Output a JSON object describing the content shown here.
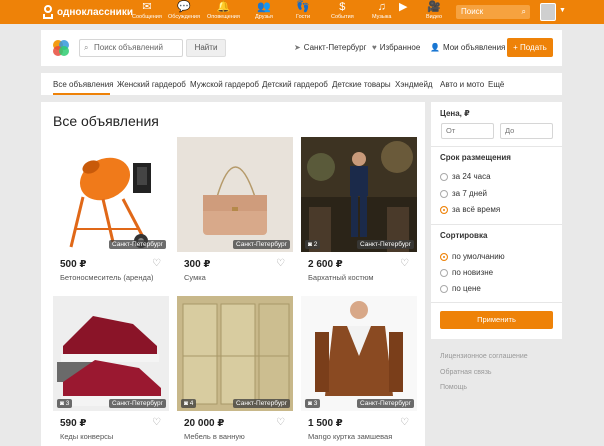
{
  "topbar": {
    "logo_text": "одноклассники",
    "nav": [
      {
        "icon": "envelope-icon",
        "glyph": "✉",
        "label": "Сообщения"
      },
      {
        "icon": "chat-icon",
        "glyph": "💬",
        "label": "Обсуждения"
      },
      {
        "icon": "bell-icon",
        "glyph": "🔔",
        "label": "Оповещения"
      },
      {
        "icon": "friends-icon",
        "glyph": "👥",
        "label": "Друзья"
      },
      {
        "icon": "footprints-icon",
        "glyph": "👣",
        "label": "Гости"
      },
      {
        "icon": "events-icon",
        "glyph": "$",
        "label": "События"
      },
      {
        "icon": "music-icon",
        "glyph": "♫",
        "label": "Музыка"
      },
      {
        "icon": "play-icon",
        "glyph": "▶",
        "label": ""
      },
      {
        "icon": "video-icon",
        "glyph": "🎥",
        "label": "Видео"
      }
    ],
    "search_placeholder": "Поиск"
  },
  "header": {
    "search_placeholder": "Поиск объявлений",
    "find_button": "Найти",
    "city": "Санкт-Петербург",
    "favorites": "Избранное",
    "my_ads": "Мои объявления",
    "add_button": "+ Подать"
  },
  "tabs": [
    "Все объявления",
    "Женский гардероб",
    "Мужской гардероб",
    "Детский гардероб",
    "Детские товары",
    "Хэндмейд",
    "Авто и мото",
    "Ещё"
  ],
  "page_title": "Все объявления",
  "listings": [
    {
      "price": "500 ₽",
      "name": "Бетоносмеситель (аренда)",
      "city": "Санкт-Петербург",
      "photos": ""
    },
    {
      "price": "300 ₽",
      "name": "Сумка",
      "city": "Санкт-Петербург",
      "photos": ""
    },
    {
      "price": "2 600 ₽",
      "name": "Бархатный костюм",
      "city": "Санкт-Петербург",
      "photos": "2"
    },
    {
      "price": "590 ₽",
      "name": "Кеды конверсы",
      "city": "Санкт-Петербург",
      "photos": "3"
    },
    {
      "price": "20 000 ₽",
      "name": "Мебель в ванную",
      "city": "Санкт-Петербург",
      "photos": "4"
    },
    {
      "price": "1 500 ₽",
      "name": "Mango куртка замшевая",
      "city": "Санкт-Петербург",
      "photos": "3"
    }
  ],
  "filters": {
    "price": {
      "title": "Цена, ₽",
      "from_placeholder": "От",
      "to_placeholder": "До"
    },
    "period": {
      "title": "Срок размещения",
      "options": [
        "за 24 часа",
        "за 7 дней",
        "за всё время"
      ],
      "selected": 2
    },
    "sort": {
      "title": "Сортировка",
      "options": [
        "по умолчанию",
        "по новизне",
        "по цене"
      ],
      "selected": 0
    },
    "apply_button": "Применить"
  },
  "footer_links": [
    "Лицензионное соглашение",
    "Обратная связь",
    "Помощь"
  ],
  "colors": {
    "accent": "#ee8208"
  }
}
